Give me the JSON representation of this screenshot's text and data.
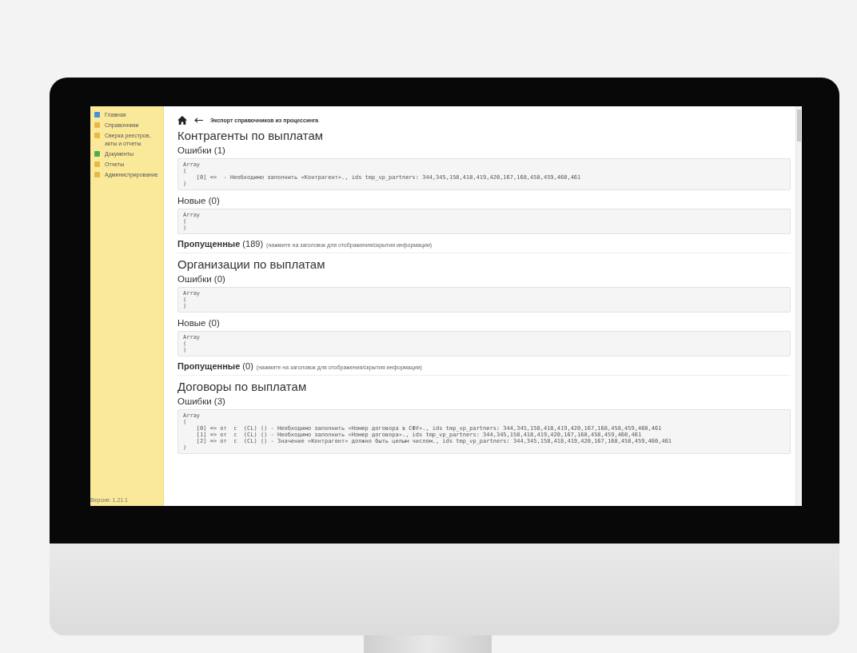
{
  "sidebar": {
    "items": [
      {
        "label": "Главная",
        "color": "#4a90d9"
      },
      {
        "label": "Справочники",
        "color": "#e8b84a"
      },
      {
        "label": "Сверка реестров, акты и отчеты",
        "color": "#e8b84a"
      },
      {
        "label": "Документы",
        "color": "#4caf50"
      },
      {
        "label": "Отчеты",
        "color": "#e8b84a"
      },
      {
        "label": "Администрирование",
        "color": "#e8b84a"
      }
    ],
    "version": "Версия: 1.21.1"
  },
  "header": {
    "title": "Экспорт справочников из процессинга"
  },
  "sections": [
    {
      "title": "Контрагенты по выплатам",
      "blocks": [
        {
          "kind": "subheading",
          "text": "Ошибки (1)"
        },
        {
          "kind": "code",
          "lines": [
            "Array",
            "(",
            "    [0] =>  - Необходимо заполнить «Контрагент»., ids tmp_vp_partners: 344,345,158,418,419,420,167,168,458,459,460,461",
            ")"
          ]
        },
        {
          "kind": "subheading",
          "text": "Новые (0)"
        },
        {
          "kind": "code",
          "lines": [
            "Array",
            "(",
            ")"
          ]
        },
        {
          "kind": "toggle",
          "text": "**Пропущенные** (189)",
          "hint": "(нажмите на заголовок для отображения/скрытия информации)"
        }
      ]
    },
    {
      "title": "Организации по выплатам",
      "blocks": [
        {
          "kind": "subheading",
          "text": "Ошибки (0)"
        },
        {
          "kind": "code",
          "lines": [
            "Array",
            "(",
            ")"
          ]
        },
        {
          "kind": "subheading",
          "text": "Новые (0)"
        },
        {
          "kind": "code",
          "lines": [
            "Array",
            "(",
            ")"
          ]
        },
        {
          "kind": "toggle",
          "text": "**Пропущенные** (0)",
          "hint": "(нажмите на заголовок для отображения/скрытия информации)"
        }
      ]
    },
    {
      "title": "Договоры по выплатам",
      "blocks": [
        {
          "kind": "subheading",
          "text": "Ошибки (3)"
        },
        {
          "kind": "code",
          "lines": [
            "Array",
            "(",
            "    [0] => от  с  (CL) () - Необходимо заполнить «Номер договора в СФУ»., ids tmp_vp_partners: 344,345,158,418,419,420,167,168,458,459,460,461",
            "    [1] => от  с  (CL) () - Необходимо заполнить «Номер договора»., ids tmp_vp_partners: 344,345,158,418,419,420,167,168,458,459,460,461",
            "    [2] => от  с  (CL) () - Значение «Контрагент» должно быть целым числом., ids tmp_vp_partners: 344,345,158,418,419,420,167,168,458,459,460,461",
            ")"
          ]
        }
      ]
    }
  ]
}
